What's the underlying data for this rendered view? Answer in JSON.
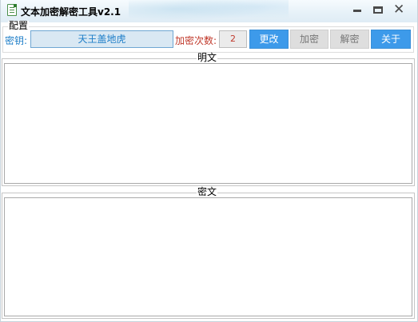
{
  "window": {
    "title": "文本加密解密工具v2.1"
  },
  "config": {
    "group_label": "配置",
    "key_label": "密钥:",
    "key_value": "天王盖地虎",
    "count_label": "加密次数:",
    "count_value": "2",
    "buttons": {
      "change": "更改",
      "encrypt": "加密",
      "decrypt": "解密",
      "about": "关于"
    }
  },
  "plaintext": {
    "group_label": "明文",
    "value": ""
  },
  "ciphertext": {
    "group_label": "密文",
    "value": ""
  },
  "icons": {
    "app": "document-icon",
    "minimize": "minimize-icon",
    "maximize": "maximize-icon",
    "close": "close-icon"
  },
  "colors": {
    "accent_button": "#3d9aea",
    "disabled_button": "#dedede",
    "key_text": "#1e7ec8",
    "count_text": "#c0392b",
    "key_field_bg": "#d9e8f3"
  }
}
